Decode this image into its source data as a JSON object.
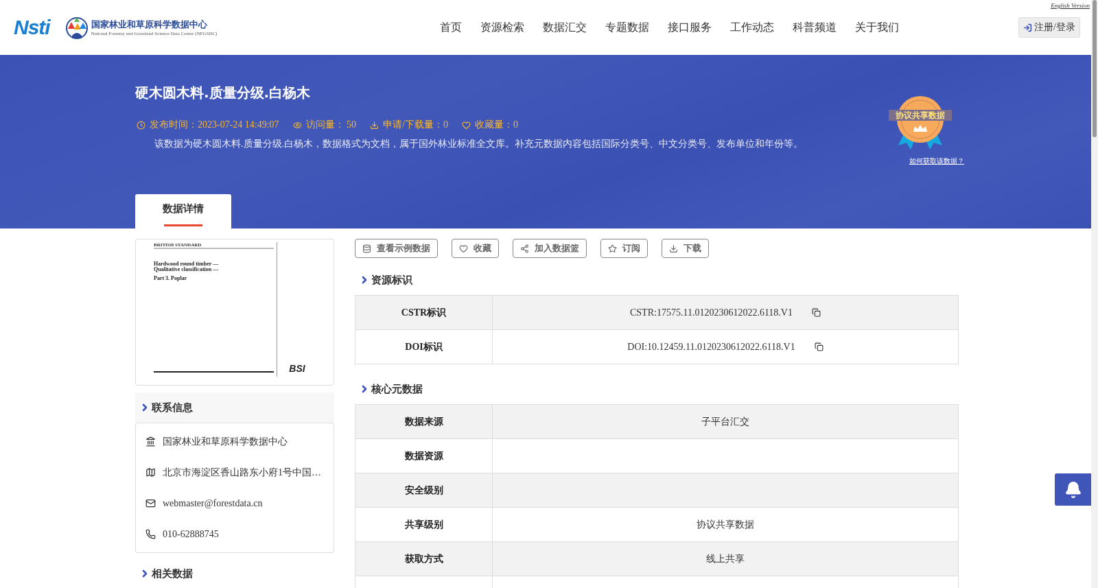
{
  "header": {
    "english_link": "English Version",
    "logo_text": "Nsti",
    "org_name": "国家林业和草原科学数据中心",
    "org_name_en": "National Forestry and Grassland Science Data Center (NFGSDC)",
    "nav": [
      {
        "label": "首页"
      },
      {
        "label": "资源检索"
      },
      {
        "label": "数据汇交"
      },
      {
        "label": "专题数据"
      },
      {
        "label": "接口服务"
      },
      {
        "label": "工作动态"
      },
      {
        "label": "科普频道"
      },
      {
        "label": "关于我们"
      }
    ],
    "login_button": "注册/登录"
  },
  "banner": {
    "title": "硬木圆木料.质量分级.白杨木",
    "meta": [
      {
        "kind": "time",
        "text": "发布时间：2023-07-24 14:49:07"
      },
      {
        "kind": "views",
        "text": "访问量： 50"
      },
      {
        "kind": "downloads",
        "text": "申请/下载量：0"
      },
      {
        "kind": "favorites",
        "text": "收藏量：0"
      }
    ],
    "description": "该数据为硬木圆木料.质量分级.白杨木，数据格式为文档，属于国外林业标准全文库。补充元数据内容包括国际分类号、中文分类号、发布单位和年份等。",
    "badge": "协议共享数据",
    "badge_link": "如何获取该数据？"
  },
  "tabs": [
    {
      "label": "数据详情",
      "selected": true
    }
  ],
  "preview": {
    "header": "BRITISH STANDARD",
    "title_lines": [
      "Hardwood round timber —",
      "Qualitative classification —"
    ],
    "part": "Part 3. Poplar",
    "brand": "BSI"
  },
  "contact": {
    "title": "联系信息",
    "items": [
      {
        "kind": "org",
        "text": "国家林业和草原科学数据中心"
      },
      {
        "kind": "address",
        "text": "北京市海淀区香山路东小府1号中国…"
      },
      {
        "kind": "email",
        "text": "webmaster@forestdata.cn"
      },
      {
        "kind": "phone",
        "text": "010-62888745"
      }
    ]
  },
  "related": {
    "title": "相关数据"
  },
  "actions": [
    {
      "kind": "sample",
      "label": "查看示例数据"
    },
    {
      "kind": "favorite",
      "label": "收藏"
    },
    {
      "kind": "basket",
      "label": "加入数据篮"
    },
    {
      "kind": "subscribe",
      "label": "订阅"
    },
    {
      "kind": "download",
      "label": "下载"
    }
  ],
  "identifiers": {
    "title": "资源标识",
    "rows": [
      {
        "label": "CSTR标识",
        "value": "CSTR:17575.11.0120230612022.6118.V1",
        "copy": true
      },
      {
        "label": "DOI标识",
        "value": "DOI:10.12459.11.0120230612022.6118.V1",
        "copy": true
      }
    ]
  },
  "core_metadata": {
    "title": "核心元数据",
    "rows": [
      {
        "label": "数据来源",
        "value": "子平台汇交"
      },
      {
        "label": "数据资源"
      },
      {
        "label": "安全级别"
      },
      {
        "label": "共享级别",
        "value": "协议共享数据"
      },
      {
        "label": "获取方式",
        "value": "线上共享"
      }
    ]
  }
}
